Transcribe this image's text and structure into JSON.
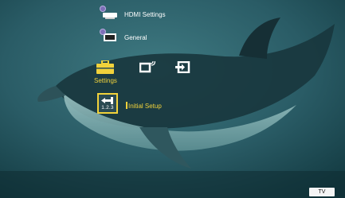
{
  "menu": {
    "hdmi_settings": "HDMI Settings",
    "general": "General"
  },
  "categories": {
    "settings": {
      "label": "Settings",
      "icon": "toolbox-icon"
    },
    "network": {
      "icon": "network-icon"
    },
    "input": {
      "icon": "input-icon"
    }
  },
  "submenu": {
    "initial_setup": {
      "label": "Initial Setup",
      "icon_text": "1.2.3"
    }
  },
  "status": {
    "tv_badge": "TV"
  },
  "colors": {
    "accent": "#f1d23b",
    "dot": "#7d6fb8"
  }
}
